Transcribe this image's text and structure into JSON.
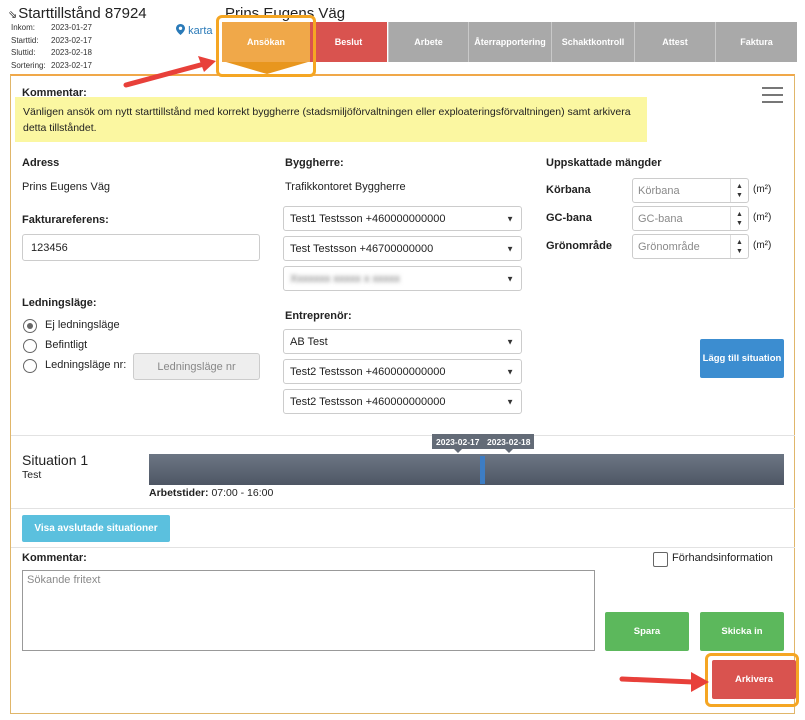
{
  "header": {
    "permit_title": "Starttillstånd 87924",
    "street_title": "Prins Eugens Väg",
    "karta_label": "karta",
    "meta": [
      {
        "label": "Inkom:",
        "value": "2023-01-27"
      },
      {
        "label": "Starttid:",
        "value": "2023-02-17"
      },
      {
        "label": "Sluttid:",
        "value": "2023-02-18"
      },
      {
        "label": "Sortering:",
        "value": "2023-02-17"
      }
    ]
  },
  "tabs": [
    {
      "label": "Ansökan",
      "state": "active"
    },
    {
      "label": "Beslut",
      "state": "rejected"
    },
    {
      "label": "Arbete",
      "state": "inactive"
    },
    {
      "label": "Återrapportering",
      "state": "inactive"
    },
    {
      "label": "Schaktkontroll",
      "state": "inactive"
    },
    {
      "label": "Attest",
      "state": "inactive"
    },
    {
      "label": "Faktura",
      "state": "inactive"
    }
  ],
  "comment_top": {
    "label": "Kommentar:",
    "text": "Vänligen ansök om nytt starttillstånd med korrekt byggherre (stadsmiljöförvaltningen eller exploateringsförvaltningen) samt arkivera detta tillståndet."
  },
  "address": {
    "label": "Adress",
    "value": "Prins Eugens Väg"
  },
  "invoice_ref": {
    "label": "Fakturareferens:",
    "value": "123456"
  },
  "cable_position": {
    "label": "Ledningsläge:",
    "options": [
      "Ej ledningsläge",
      "Befintligt",
      "Ledningsläge nr:"
    ],
    "selected": "Ej ledningsläge",
    "nr_placeholder": "Ledningsläge nr"
  },
  "builder": {
    "label": "Byggherre:",
    "value": "Trafikkontoret Byggherre",
    "contacts": [
      "Test1 Testsson +460000000000",
      "Test Testsson +46700000000",
      "Xxxxxxx xxxxx x xxxxx"
    ]
  },
  "contractor": {
    "label": "Entreprenör:",
    "company": "AB Test",
    "contacts": [
      "Test2 Testsson +460000000000",
      "Test2 Testsson +460000000000"
    ]
  },
  "quantities": {
    "label": "Uppskattade mängder",
    "unit": "(m²)",
    "rows": [
      {
        "label": "Körbana",
        "placeholder": "Körbana"
      },
      {
        "label": "GC-bana",
        "placeholder": "GC-bana"
      },
      {
        "label": "Grönområde",
        "placeholder": "Grönområde"
      }
    ]
  },
  "add_situation_label": "Lägg till situation",
  "situation": {
    "title": "Situation 1",
    "subtitle": "Test",
    "start_date": "2023-02-17",
    "end_date": "2023-02-18",
    "work_hours_label": "Arbetstider:",
    "work_hours": "07:00 - 16:00"
  },
  "show_finished_label": "Visa avslutade situationer",
  "comment_bottom": {
    "label": "Kommentar:",
    "placeholder": "Sökande fritext",
    "preinfo_label": "Förhandsinformation"
  },
  "actions": {
    "save": "Spara",
    "submit": "Skicka in",
    "archive": "Arkivera"
  },
  "colors": {
    "accent_orange": "#f0a849",
    "red": "#d9534f",
    "green": "#5cb85c",
    "blue": "#3c8dd0",
    "annotation_arrow": "#e8403a",
    "annotation_highlight": "#f5a623"
  }
}
